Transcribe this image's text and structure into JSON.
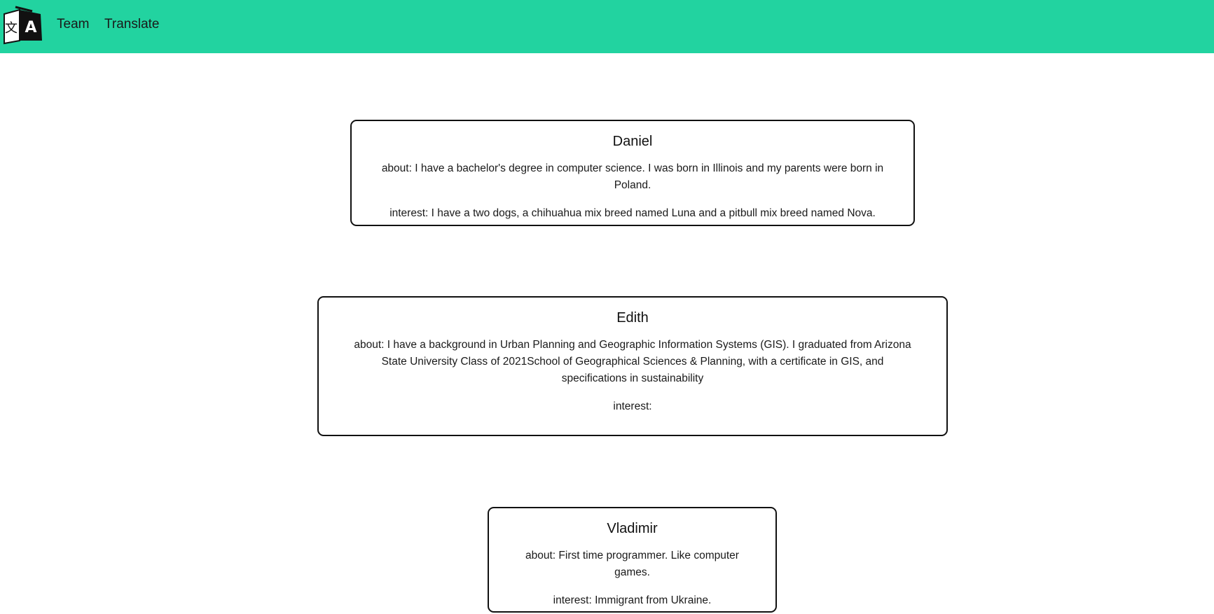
{
  "nav": {
    "logo_icon": "translate-logo-icon",
    "links": [
      "Team",
      "Translate"
    ]
  },
  "team": [
    {
      "name": "Daniel",
      "about": "about: I have a bachelor's degree in computer science. I was born in Illinois and my parents were born in Poland.",
      "interest": "interest: I have a two dogs, a chihuahua mix breed named Luna and a pitbull mix breed named Nova."
    },
    {
      "name": "Edith",
      "about": "about: I have a background in Urban Planning and Geographic Information Systems (GIS). I graduated from Arizona State University Class of 2021School of Geographical Sciences & Planning, with a certificate in GIS, and specifications in sustainability",
      "interest": "interest:"
    },
    {
      "name": "Vladimir",
      "about": "about: First time programmer. Like computer games.",
      "interest": "interest: Immigrant from Ukraine."
    }
  ],
  "colors": {
    "navbar": "#22d3a0",
    "card_border": "#111111"
  }
}
